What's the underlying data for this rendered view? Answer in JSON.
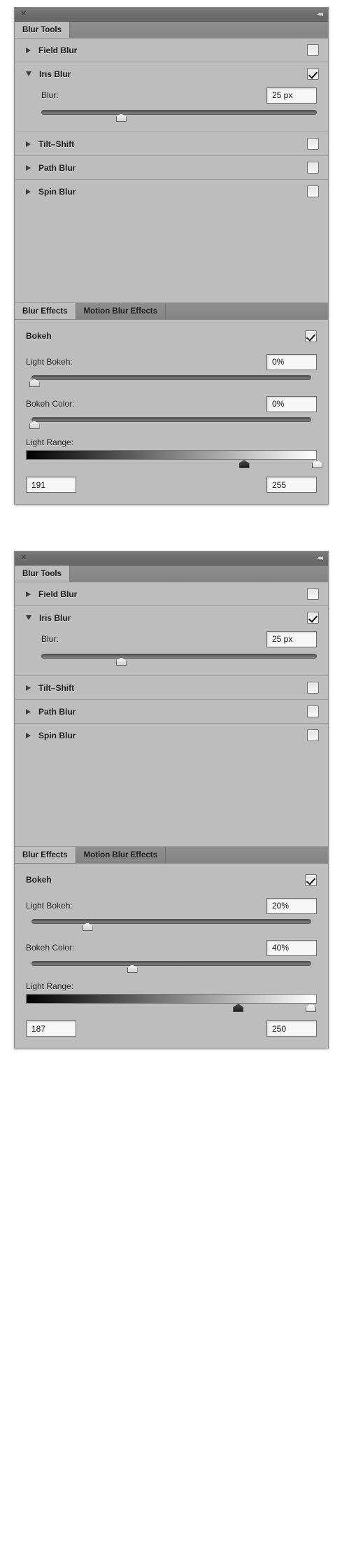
{
  "titlebar": {
    "close_icon": "close-icon",
    "collapse_icon": "collapse-arrows-icon",
    "close_glyph": "✕",
    "collapse_glyph": "◂◂"
  },
  "tools_tabs": {
    "blur_tools": "Blur Tools"
  },
  "effects_tabs": {
    "blur_effects": "Blur Effects",
    "motion_blur_effects": "Motion Blur Effects"
  },
  "labels": {
    "blur": "Blur:",
    "bokeh": "Bokeh",
    "light_bokeh": "Light Bokeh:",
    "bokeh_color": "Bokeh Color:",
    "light_range": "Light Range:"
  },
  "colors": {
    "panel_bg": "#bdbdbd",
    "titlebar": "#6d6d6d",
    "tab_inactive": "#8a8a8a",
    "tab_active": "#bdbdbd",
    "input_bg": "#f7f7f7",
    "track": "#6a6a6a"
  },
  "panels": [
    {
      "id": "panel-1",
      "tools": [
        {
          "name": "field-blur",
          "label": "Field Blur",
          "expanded": false,
          "checked": false
        },
        {
          "name": "iris-blur",
          "label": "Iris Blur",
          "expanded": true,
          "checked": true,
          "blur_value": "25 px",
          "blur_slider_pct": 29
        },
        {
          "name": "tilt-shift",
          "label": "Tilt–Shift",
          "expanded": false,
          "checked": false
        },
        {
          "name": "path-blur",
          "label": "Path Blur",
          "expanded": false,
          "checked": false
        },
        {
          "name": "spin-blur",
          "label": "Spin Blur",
          "expanded": false,
          "checked": false
        }
      ],
      "effects": {
        "bokeh_checked": true,
        "light_bokeh": {
          "value": "0%",
          "slider_pct": 1
        },
        "bokeh_color": {
          "value": "0%",
          "slider_pct": 1
        },
        "light_range": {
          "min_value": "191",
          "max_value": "255",
          "min_pct": 75,
          "max_pct": 100
        }
      }
    },
    {
      "id": "panel-2",
      "tools": [
        {
          "name": "field-blur",
          "label": "Field Blur",
          "expanded": false,
          "checked": false
        },
        {
          "name": "iris-blur",
          "label": "Iris Blur",
          "expanded": true,
          "checked": true,
          "blur_value": "25 px",
          "blur_slider_pct": 29
        },
        {
          "name": "tilt-shift",
          "label": "Tilt–Shift",
          "expanded": false,
          "checked": false
        },
        {
          "name": "path-blur",
          "label": "Path Blur",
          "expanded": false,
          "checked": false
        },
        {
          "name": "spin-blur",
          "label": "Spin Blur",
          "expanded": false,
          "checked": false
        }
      ],
      "effects": {
        "bokeh_checked": true,
        "light_bokeh": {
          "value": "20%",
          "slider_pct": 20
        },
        "bokeh_color": {
          "value": "40%",
          "slider_pct": 36
        },
        "light_range": {
          "min_value": "187",
          "max_value": "250",
          "min_pct": 73,
          "max_pct": 98
        }
      }
    }
  ]
}
